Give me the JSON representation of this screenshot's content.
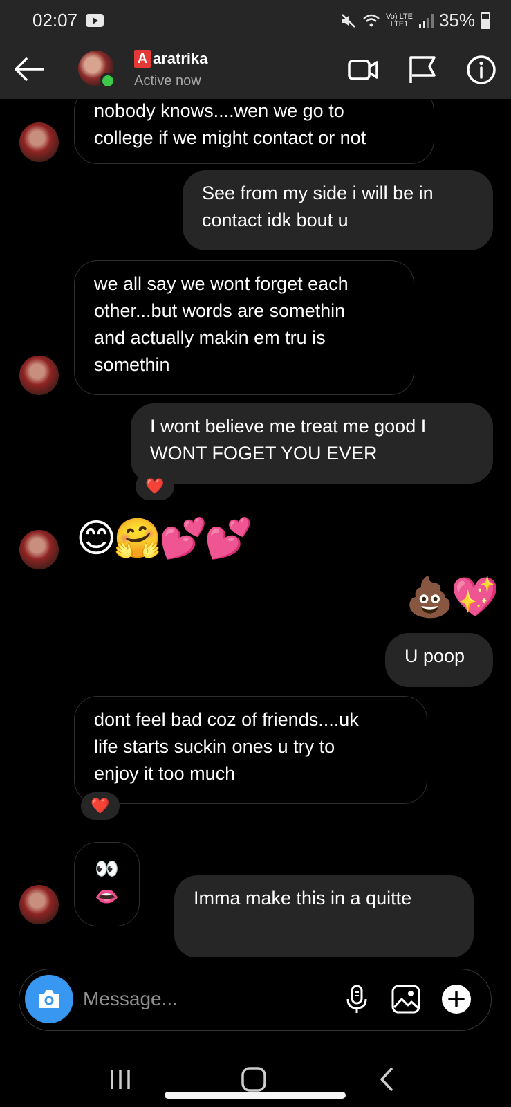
{
  "status_bar": {
    "time": "02:07",
    "network_top": "Vo) LTE",
    "network_bottom": "LTE1",
    "battery": "35%"
  },
  "header": {
    "contact_badge": "A",
    "contact_name": "aratrika",
    "contact_status": "Active now",
    "icons": [
      "back-arrow-icon",
      "video-call-icon",
      "flag-icon",
      "info-icon"
    ]
  },
  "messages": [
    {
      "from": "them",
      "text_lines": [
        "nobody knows....wen we go to",
        "college if we might contact or not"
      ]
    },
    {
      "from": "me",
      "text_lines": [
        "See from my side i will be in",
        "contact idk bout u"
      ]
    },
    {
      "from": "them",
      "text_lines": [
        "we all say we wont forget each",
        "other...but words are somethin",
        "and actually makin em tru is",
        "somethin"
      ]
    },
    {
      "from": "me",
      "text_lines": [
        "I wont believe me treat me good I",
        "WONT FOGET YOU EVER"
      ],
      "reaction": "❤️"
    },
    {
      "from": "them",
      "emoji": "😊🤗💕💕"
    },
    {
      "from": "me",
      "emoji": "💩💖"
    },
    {
      "from": "me",
      "text_lines": [
        "U poop"
      ]
    },
    {
      "from": "them",
      "text_lines": [
        "dont feel bad coz of friends....uk",
        "life starts suckin ones u try to",
        "enjoy it too much"
      ],
      "reaction": "❤️"
    },
    {
      "from": "them",
      "emoji_lines": [
        "👀",
        "👄"
      ]
    },
    {
      "from": "me",
      "text_lines": [
        "Imma make this in a quitte"
      ]
    }
  ],
  "composer": {
    "placeholder": "Message...",
    "icons": [
      "camera-icon",
      "microphone-icon",
      "gallery-icon",
      "plus-icon"
    ]
  },
  "nav_bar": {
    "icons": [
      "recent-apps-icon",
      "home-icon",
      "nav-back-icon"
    ]
  },
  "colors": {
    "background": "#000000",
    "bars": "#262626",
    "outgoing_bubble": "#262626",
    "incoming_border": "#2f2f2f",
    "camera_button": "#3897f0",
    "online_dot": "#3ec74b",
    "reaction_heart": "#ff2d4b"
  }
}
